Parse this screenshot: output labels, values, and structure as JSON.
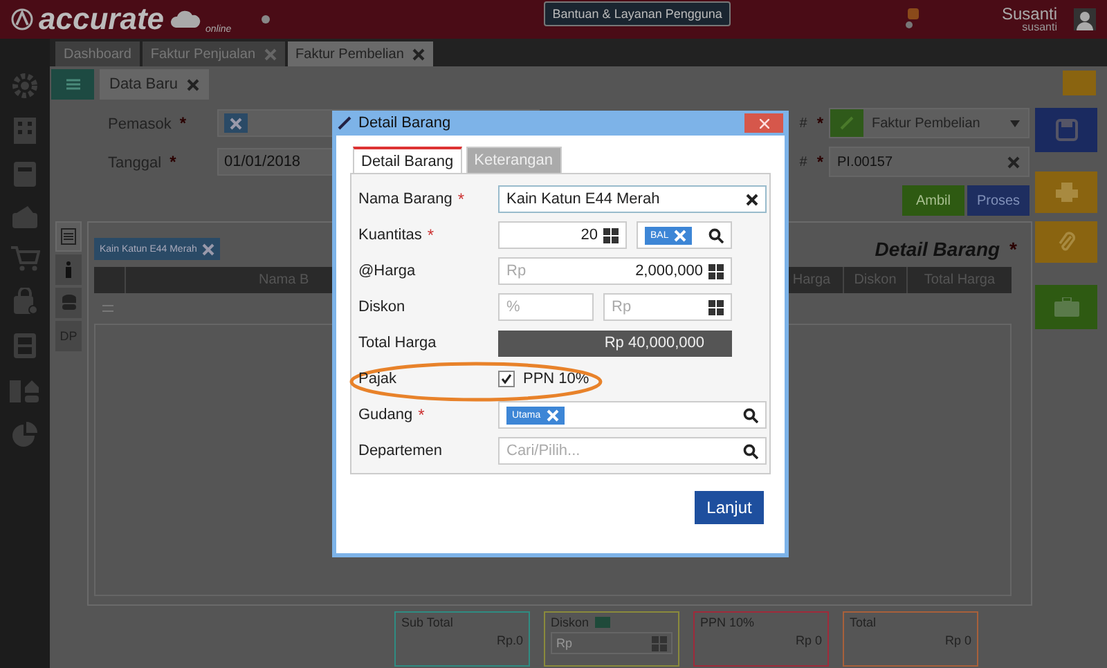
{
  "app": {
    "logo": "accurate",
    "logo_sub": "online",
    "help_button": "Bantuan & Layanan Pengguna",
    "user_name": "Susanti",
    "user_id": "susanti"
  },
  "page_tabs": [
    {
      "label": "Dashboard",
      "selected": false,
      "closable": false
    },
    {
      "label": "Faktur Penjualan",
      "selected": false,
      "closable": true
    },
    {
      "label": "Faktur Pembelian",
      "selected": true,
      "closable": true
    }
  ],
  "form_tab": {
    "label": "Data Baru"
  },
  "header_fields": [
    {
      "label": "Pemasok",
      "mark": "*",
      "kind": "chip"
    },
    {
      "label": "Tanggal",
      "mark": "*",
      "kind": "text",
      "value": "01/01/2018"
    }
  ],
  "right_fields": [
    {
      "label": "#",
      "mark": "*",
      "kind": "dropdown",
      "value": "Faktur Pembelian"
    },
    {
      "label": "#",
      "mark": "*",
      "kind": "clearable",
      "value": "PI.00157"
    }
  ],
  "actions": [
    {
      "label": "Ambil",
      "kind": "green"
    },
    {
      "label": "Proses",
      "kind": "blue"
    }
  ],
  "detail": {
    "filter_chip": "Kain Katun E44 Merah",
    "title": "Detail Barang",
    "title_mark": "*",
    "side_tabs": [
      {
        "kind": "list",
        "selected": true
      },
      {
        "kind": "info",
        "selected": false
      },
      {
        "kind": "stack",
        "selected": false
      },
      {
        "kind": "text",
        "label": "DP",
        "selected": false
      }
    ],
    "columns": [
      "Nama B",
      "Harga",
      "Diskon",
      "Total Harga"
    ]
  },
  "totals": [
    {
      "label": "Sub Total",
      "kind": "amount",
      "value": "Rp.0",
      "color": "#2f8c82"
    },
    {
      "label": "Diskon",
      "kind": "input",
      "placeholder": "Rp",
      "color": "#8a8a3c"
    },
    {
      "label": "PPN 10%",
      "kind": "amount",
      "value": "Rp 0",
      "color": "#a02a3a"
    },
    {
      "label": "Total",
      "kind": "amount",
      "value": "Rp 0",
      "color": "#a8603a"
    }
  ],
  "dialog": {
    "title": "Detail Barang",
    "tabs": [
      {
        "label": "Detail Barang",
        "selected": true
      },
      {
        "label": "Keterangan",
        "selected": false
      }
    ],
    "rows": [
      {
        "kind": "text",
        "label": "Nama Barang",
        "mark": "*",
        "value": "Kain Katun E44 Merah",
        "highlighted": false
      },
      {
        "kind": "quantity",
        "label": "Kuantitas",
        "mark": "*",
        "value": "20",
        "unit": "BAL",
        "highlighted": false
      },
      {
        "kind": "price",
        "label": "@Harga",
        "prefix": "Rp",
        "value": "2,000,000",
        "highlighted": false
      },
      {
        "kind": "discount",
        "label": "Diskon",
        "placeholder": "%",
        "placeholder2": "Rp",
        "highlighted": false
      },
      {
        "kind": "total",
        "label": "Total Harga",
        "value": "Rp 40,000,000",
        "highlighted": false
      },
      {
        "kind": "checkbox",
        "label": "Pajak",
        "checked": true,
        "text": "PPN 10%",
        "highlighted": true
      },
      {
        "kind": "lookup",
        "label": "Gudang",
        "mark": "*",
        "chip": "Utama",
        "highlighted": false
      },
      {
        "kind": "lookup",
        "label": "Departemen",
        "placeholder": "Cari/Pilih...",
        "highlighted": false
      }
    ],
    "button": "Lanjut"
  }
}
